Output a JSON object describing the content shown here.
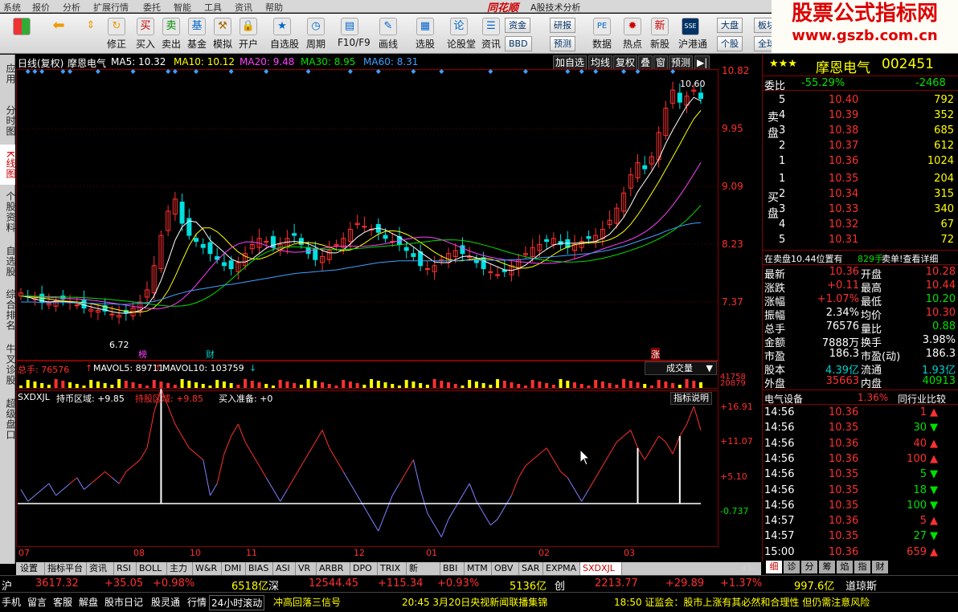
{
  "menu": [
    "系统",
    "报价",
    "分析",
    "扩展行情",
    "委托",
    "智能",
    "工具",
    "资讯",
    "帮助"
  ],
  "app_title": "A股技术分析",
  "brand": "同花顺",
  "toolbar": [
    {
      "label": "",
      "icon": "four-squares-icon"
    },
    {
      "label": "",
      "icon": "arrow-left-icon"
    },
    {
      "label": "",
      "icon": "arrow-up-down-icon"
    },
    {
      "label": "修正",
      "icon": "refresh-icon"
    },
    {
      "label": "买入",
      "icon": "buy-icon"
    },
    {
      "label": "卖出",
      "icon": "sell-icon"
    },
    {
      "label": "基金",
      "icon": "fund-icon"
    },
    {
      "label": "模拟",
      "icon": "hammer-icon"
    },
    {
      "label": "开户",
      "icon": "lock-icon"
    },
    {
      "label": "自选股",
      "icon": "star-icon"
    },
    {
      "label": "周期",
      "icon": "clock-icon"
    },
    {
      "label": "F10/F9",
      "icon": "f10-icon"
    },
    {
      "label": "画线",
      "icon": "pencil-icon"
    },
    {
      "label": "选股",
      "icon": "filter-icon"
    },
    {
      "label": "论股堂",
      "icon": "forum-icon"
    },
    {
      "label": "资讯",
      "icon": "news-icon"
    },
    {
      "label": "数据",
      "icon": "pe-icon"
    },
    {
      "label": "热点",
      "icon": "hot-icon"
    },
    {
      "label": "新股",
      "icon": "ipo-icon"
    },
    {
      "label": "沪港通",
      "icon": "hk-icon"
    }
  ],
  "toolbar_small": {
    "zijin": "资金",
    "bbd": "BBD",
    "yanbao": "研报",
    "yuce": "预测",
    "dapan": "大盘",
    "gegu": "个股",
    "bankuai": "板块",
    "quanqiu": "全球"
  },
  "watermark": {
    "line1": "股票公式指标网",
    "line2": "www.gszb.com.cn"
  },
  "left_nav": [
    {
      "label": "应用",
      "active": false
    },
    {
      "label": "分时图",
      "active": false
    },
    {
      "label": "K线图",
      "active": true
    },
    {
      "label": "个股资料",
      "active": false
    },
    {
      "label": "自选股",
      "active": false
    },
    {
      "label": "综合排名",
      "active": false
    },
    {
      "label": "牛叉诊股",
      "active": false
    },
    {
      "label": "超级盘口",
      "active": false
    }
  ],
  "chart_header": {
    "period": "日线(复权)",
    "name": "摩恩电气",
    "ma5": "MA5: 10.32",
    "ma10": "MA10: 10.12",
    "ma20": "MA20: 9.48",
    "ma30": "MA30: 8.95",
    "ma60": "MA60: 8.31",
    "buttons": [
      "加自选",
      "均线",
      "复权",
      "叠",
      "窗",
      "预测"
    ]
  },
  "price_axis": [
    "10.82",
    "9.95",
    "9.09",
    "8.23",
    "7.37"
  ],
  "price_labels": {
    "high": "10.60",
    "low": "6.72"
  },
  "event_marks": [
    {
      "label": "榜",
      "color": "#ff40ff"
    },
    {
      "label": "财",
      "color": "#00d0d0"
    },
    {
      "label": "涨",
      "color": "#ffffff"
    }
  ],
  "volume_header": {
    "total": "总手: 76576",
    "mavol5": "MAVOL5: 89711",
    "mavol10": "MAVOL10: 103759",
    "selector": "成交量"
  },
  "volume_axis": [
    "41758",
    "20879"
  ],
  "indicator_header": {
    "name": "SXDXJL",
    "hold": "持币区域: +9.85",
    "holdstock": "持股区域: +9.85",
    "prep": "买入准备: +0",
    "help": "指标说明"
  },
  "indicator_axis": [
    "+16.91",
    "+11.07",
    "+5.10",
    "-0.737"
  ],
  "x_axis": [
    "07",
    "08",
    "10",
    "11",
    "12",
    "01",
    "02",
    "03"
  ],
  "chart_data": {
    "type": "line",
    "title": "摩恩电气 日线(复权)",
    "ylim": [
      6.5,
      10.9
    ],
    "close": [
      7.15,
      7.1,
      7.05,
      7.0,
      6.98,
      7.02,
      7.05,
      7.0,
      6.95,
      6.9,
      6.88,
      6.86,
      6.85,
      6.8,
      6.78,
      6.82,
      6.9,
      7.0,
      7.2,
      7.6,
      8.1,
      8.5,
      8.7,
      8.3,
      8.1,
      8.0,
      7.9,
      7.8,
      7.7,
      7.6,
      7.55,
      7.65,
      7.8,
      7.95,
      8.05,
      8.0,
      7.9,
      7.95,
      8.05,
      8.1,
      7.95,
      7.8,
      7.7,
      7.75,
      7.85,
      7.95,
      8.05,
      8.2,
      8.3,
      8.25,
      8.2,
      8.15,
      8.05,
      8.0,
      7.95,
      7.85,
      7.75,
      7.6,
      7.55,
      7.6,
      7.7,
      7.8,
      7.85,
      7.8,
      7.75,
      7.65,
      7.55,
      7.5,
      7.45,
      7.5,
      7.6,
      7.7,
      7.8,
      7.9,
      7.95,
      8.0,
      8.05,
      7.95,
      7.9,
      7.95,
      8.0,
      8.05,
      8.1,
      8.2,
      8.35,
      8.55,
      8.8,
      9.1,
      9.3,
      9.2,
      9.4,
      9.8,
      10.2,
      10.5,
      10.3,
      10.4,
      10.5,
      10.36
    ],
    "ma5": [
      7.1,
      7.08,
      7.05,
      7.02,
      7.0,
      7.01,
      7.01,
      7.0,
      6.98,
      6.95,
      6.92,
      6.89,
      6.87,
      6.84,
      6.82,
      6.81,
      6.83,
      6.86,
      6.94,
      7.1,
      7.36,
      7.68,
      8.02,
      8.24,
      8.34,
      8.32,
      8.2,
      8.02,
      7.92,
      7.82,
      7.71,
      7.66,
      7.66,
      7.71,
      7.8,
      7.89,
      7.94,
      7.97,
      7.99,
      8.0,
      7.99,
      7.96,
      7.91,
      7.85,
      7.81,
      7.81,
      7.86,
      7.96,
      8.07,
      8.15,
      8.2,
      8.22,
      8.19,
      8.13,
      8.07,
      7.99,
      7.91,
      7.82,
      7.74,
      7.66,
      7.65,
      7.65,
      7.7,
      7.75,
      7.76,
      7.73,
      7.68,
      7.63,
      7.58,
      7.53,
      7.52,
      7.55,
      7.61,
      7.7,
      7.79,
      7.87,
      7.94,
      7.97,
      7.97,
      7.97,
      7.98,
      7.99,
      8.0,
      8.05,
      8.12,
      8.25,
      8.4,
      8.6,
      8.82,
      8.99,
      9.16,
      9.36,
      9.62,
      9.84,
      10.04,
      10.24,
      10.38,
      10.32
    ],
    "ma60": [
      7.0,
      7.0,
      7.0,
      6.99,
      6.99,
      6.99,
      6.99,
      6.99,
      6.98,
      6.98,
      6.98,
      6.97,
      6.97,
      6.97,
      6.96,
      6.96,
      6.97,
      6.98,
      6.99,
      7.01,
      7.04,
      7.08,
      7.12,
      7.15,
      7.18,
      7.2,
      7.22,
      7.24,
      7.26,
      7.28,
      7.29,
      7.31,
      7.33,
      7.35,
      7.37,
      7.39,
      7.41,
      7.43,
      7.45,
      7.47,
      7.48,
      7.49,
      7.5,
      7.51,
      7.52,
      7.53,
      7.55,
      7.57,
      7.59,
      7.61,
      7.63,
      7.65,
      7.66,
      7.67,
      7.68,
      7.68,
      7.68,
      7.68,
      7.68,
      7.68,
      7.68,
      7.68,
      7.68,
      7.69,
      7.69,
      7.69,
      7.69,
      7.69,
      7.69,
      7.69,
      7.7,
      7.7,
      7.71,
      7.72,
      7.73,
      7.74,
      7.75,
      7.76,
      7.77,
      7.78,
      7.79,
      7.8,
      7.82,
      7.84,
      7.86,
      7.89,
      7.92,
      7.96,
      8.0,
      8.04,
      8.08,
      8.12,
      8.17,
      8.21,
      8.25,
      8.28,
      8.3,
      8.31
    ],
    "indicator": [
      3,
      1,
      2,
      3,
      4,
      2,
      3,
      4,
      5,
      3,
      4,
      5,
      6,
      5,
      4,
      6,
      7,
      8,
      10,
      16,
      20,
      17,
      14,
      12,
      10,
      9,
      8,
      2,
      4,
      9,
      12,
      14,
      11,
      9,
      7,
      5,
      3,
      1,
      3,
      5,
      7,
      9,
      11,
      13,
      10,
      8,
      6,
      4,
      2,
      0,
      -2,
      -4,
      -1,
      2,
      4,
      6,
      8,
      3,
      -1,
      -3,
      -5,
      -2,
      0,
      2,
      4,
      1,
      -1,
      -3,
      -2,
      0,
      2,
      5,
      7,
      8,
      9,
      10,
      8,
      6,
      5,
      3,
      1,
      3,
      5,
      7,
      9,
      11,
      12,
      13,
      10,
      8,
      10,
      12,
      11,
      9,
      12,
      14,
      17,
      13
    ]
  },
  "quote": {
    "stars": "★★★",
    "name": "摩恩电气",
    "code": "002451",
    "weibi_label": "委比",
    "weibi": "-55.29%",
    "weicha": "-2468",
    "sell": [
      {
        "lvl": "5",
        "price": "10.40",
        "vol": "792"
      },
      {
        "lvl": "4",
        "price": "10.39",
        "vol": "352"
      },
      {
        "lvl": "3",
        "price": "10.38",
        "vol": "685"
      },
      {
        "lvl": "2",
        "price": "10.37",
        "vol": "612"
      },
      {
        "lvl": "1",
        "price": "10.36",
        "vol": "1024"
      }
    ],
    "buy": [
      {
        "lvl": "1",
        "price": "10.35",
        "vol": "204"
      },
      {
        "lvl": "2",
        "price": "10.34",
        "vol": "315"
      },
      {
        "lvl": "3",
        "price": "10.33",
        "vol": "340"
      },
      {
        "lvl": "4",
        "price": "10.32",
        "vol": "67"
      },
      {
        "lvl": "5",
        "price": "10.31",
        "vol": "72"
      }
    ],
    "sell_side": "卖盘",
    "buy_side": "买盘",
    "notice_left": "在卖盘10.44位置有",
    "notice_vol": "829手",
    "notice_right": "卖单!查看详细",
    "stats": [
      {
        "l1": "最新",
        "v1": "10.36",
        "c1": "red",
        "l2": "开盘",
        "v2": "10.28",
        "c2": "red"
      },
      {
        "l1": "涨跌",
        "v1": "+0.11",
        "c1": "red",
        "l2": "最高",
        "v2": "10.44",
        "c2": "red"
      },
      {
        "l1": "涨幅",
        "v1": "+1.07%",
        "c1": "red",
        "l2": "最低",
        "v2": "10.20",
        "c2": "green"
      },
      {
        "l1": "振幅",
        "v1": "2.34%",
        "c1": "white",
        "l2": "均价",
        "v2": "10.30",
        "c2": "red"
      },
      {
        "l1": "总手",
        "v1": "76576",
        "c1": "white",
        "l2": "量比",
        "v2": "0.88",
        "c2": "green"
      },
      {
        "l1": "金额",
        "v1": "7888万",
        "c1": "white",
        "l2": "换手",
        "v2": "3.98%",
        "c2": "white"
      },
      {
        "l1": "市盈",
        "v1": "186.3",
        "c1": "white",
        "l2": "市盈(动)",
        "v2": "186.3",
        "c2": "white"
      },
      {
        "l1": "股本",
        "v1": "4.39亿",
        "c1": "cyan",
        "l2": "流通",
        "v2": "1.93亿",
        "c2": "cyan"
      },
      {
        "l1": "外盘",
        "v1": "35663",
        "c1": "red",
        "l2": "内盘",
        "v2": "40913",
        "c2": "green"
      }
    ],
    "sector": "电气设备",
    "sector_pct": "1.36%",
    "sector_btn": "同行业比较",
    "ticks": [
      {
        "t": "14:56",
        "p": "10.36",
        "pc": "red",
        "v": "1",
        "dir": "up"
      },
      {
        "t": "14:56",
        "p": "10.35",
        "pc": "red",
        "v": "30",
        "dir": "down"
      },
      {
        "t": "14:56",
        "p": "10.36",
        "pc": "red",
        "v": "40",
        "dir": "up"
      },
      {
        "t": "14:56",
        "p": "10.36",
        "pc": "red",
        "v": "100",
        "dir": "up"
      },
      {
        "t": "14:56",
        "p": "10.35",
        "pc": "red",
        "v": "5",
        "dir": "down"
      },
      {
        "t": "14:56",
        "p": "10.35",
        "pc": "red",
        "v": "18",
        "dir": "down"
      },
      {
        "t": "14:56",
        "p": "10.35",
        "pc": "red",
        "v": "100",
        "dir": "down"
      },
      {
        "t": "14:57",
        "p": "10.36",
        "pc": "red",
        "v": "5",
        "dir": "up"
      },
      {
        "t": "14:57",
        "p": "10.35",
        "pc": "red",
        "v": "27",
        "dir": "down"
      },
      {
        "t": "15:00",
        "p": "10.36",
        "pc": "red",
        "v": "659",
        "dir": "up"
      }
    ],
    "bottom_tabs": [
      "细",
      "诊",
      "分",
      "筹",
      "焰",
      "指",
      "财"
    ]
  },
  "bottom_tabs": [
    "设置",
    "指标平台",
    "资讯",
    "RSI",
    "BOLL",
    "主力",
    "W&R",
    "DMI",
    "BIAS",
    "ASI",
    "VR",
    "ARBR",
    "DPO",
    "TRIX",
    "新DMA",
    "BBI",
    "MTM",
    "OBV",
    "SAR",
    "EXPMA",
    "SXDXJL"
  ],
  "index_bar": {
    "sh_label": "沪",
    "sh_val": "3617.32",
    "sh_chg": "+35.05",
    "sh_pct": "+0.98%",
    "sh_amt": "6518亿",
    "sz_label": "深",
    "sz_val": "12544.45",
    "sz_chg": "+115.34",
    "sz_pct": "+0.93%",
    "sz_amt": "5136亿",
    "cy_label": "创",
    "cy_val": "2213.77",
    "cy_chg": "+29.89",
    "cy_pct": "+1.37%",
    "dj_val": "997.6亿",
    "dj_label": "道琼斯"
  },
  "status_bar": {
    "items": [
      "手机",
      "留言",
      "客服",
      "解盘",
      "股市日记",
      "股灵通",
      "行情"
    ],
    "scroll_label": "24小时滚动",
    "news1": "冲高回落三信号",
    "news2": "20:45 3月20日央视新闻联播集锦",
    "news3": "18:50 证监会：股市上涨有其必然和合理性 但仍需注意风险"
  },
  "colors": {
    "up": "#ff3030",
    "down": "#00e0e0",
    "ma5": "#ffffff",
    "ma10": "#ffff00",
    "ma20": "#ff40ff",
    "ma30": "#00e000",
    "ma60": "#40a0ff"
  }
}
